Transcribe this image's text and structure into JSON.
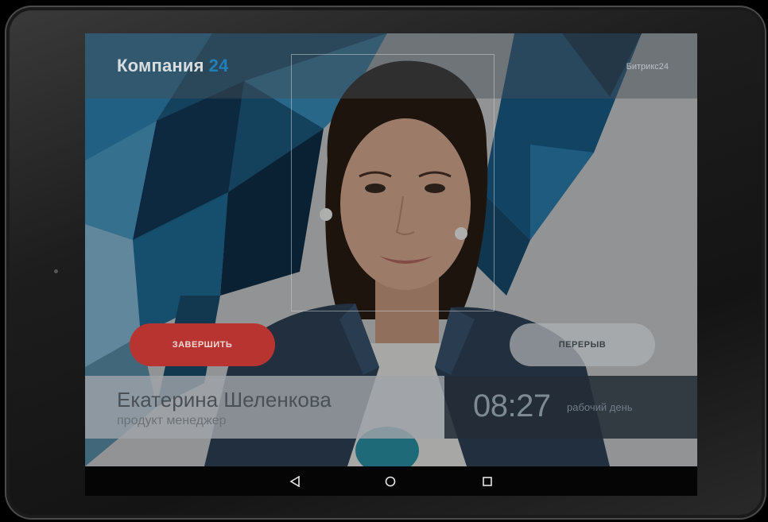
{
  "header": {
    "company_name": "Компания",
    "company_number": "24",
    "brand": "Битрикс24"
  },
  "actions": {
    "finish_label": "ЗАВЕРШИТЬ",
    "break_label": "ПЕРЕРЫВ"
  },
  "employee": {
    "name": "Екатерина Шеленкова",
    "role": "продукт менеджер"
  },
  "timer": {
    "time": "08:27",
    "label": "рабочий день"
  },
  "navbar": {
    "icons": [
      "back-icon",
      "home-icon",
      "recents-icon"
    ]
  },
  "colors": {
    "finish_button": "#b83431",
    "accent": "#1f7fb8",
    "timer_panel": "#242d37"
  }
}
